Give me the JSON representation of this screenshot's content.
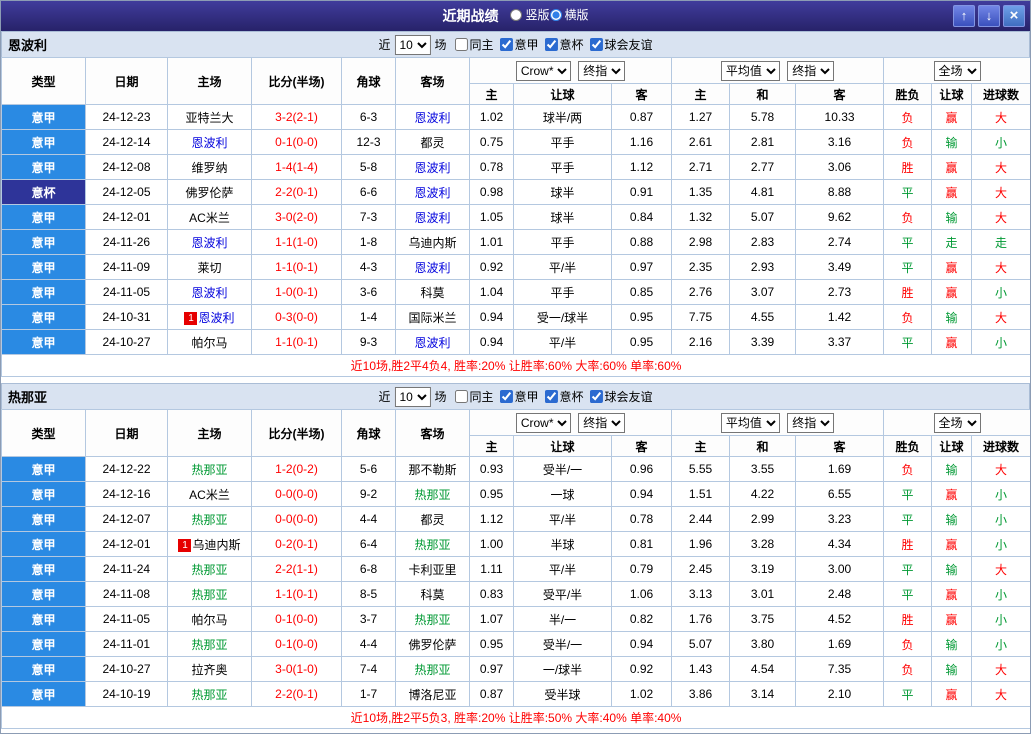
{
  "titlebar": {
    "title": "近期战绩",
    "layout_options": [
      {
        "label": "竖版",
        "selected": false
      },
      {
        "label": "横版",
        "selected": true
      }
    ],
    "up_icon": "↑",
    "down_icon": "↓",
    "close_icon": "×"
  },
  "controls": {
    "near_label": "近",
    "count": "10",
    "matches_label": "场",
    "checkboxes": [
      {
        "label": "同主",
        "checked": false
      },
      {
        "label": "意甲",
        "checked": true
      },
      {
        "label": "意杯",
        "checked": true
      },
      {
        "label": "球会友谊",
        "checked": true
      }
    ]
  },
  "header": {
    "cols": [
      "类型",
      "日期",
      "主场",
      "比分(半场)",
      "角球",
      "客场"
    ],
    "odds1": {
      "company": "Crow*",
      "time": "终指",
      "cols": [
        "主",
        "让球",
        "客"
      ]
    },
    "odds2": {
      "name": "平均值",
      "time": "终指",
      "cols": [
        "主",
        "和",
        "客"
      ]
    },
    "scope": "全场",
    "result_cols": [
      "胜负",
      "让球",
      "进球数"
    ]
  },
  "colors": {
    "league": {
      "意甲": "#2a8ae3",
      "意杯": "#2e3499"
    },
    "score": "#ff0000",
    "summary": "#ff0000",
    "mark": "#e60000",
    "outcome": {
      "胜": "#ff0000",
      "负": "#ff0000",
      "平": "#009933",
      "赢": "#ff0000",
      "输": "#009933",
      "走": "#009933",
      "大": "#ff0000",
      "小": "#009933"
    }
  },
  "sections": [
    {
      "team": "恩波利",
      "team_color": "#0000dd",
      "summary": "近10场,胜2平4负4, 胜率:20% 让胜率:60% 大率:60% 单率:60%",
      "rows": [
        {
          "lg": "意甲",
          "date": "24-12-23",
          "home": "亚特兰大",
          "score": "3-2(2-1)",
          "cor": "6-3",
          "away": "恩波利",
          "o1": "1.02",
          "hc": "球半/两",
          "o2": "0.87",
          "e1": "1.27",
          "e2": "5.78",
          "e3": "10.33",
          "r1": "负",
          "r2": "赢",
          "r3": "大"
        },
        {
          "lg": "意甲",
          "date": "24-12-14",
          "home": "恩波利",
          "score": "0-1(0-0)",
          "cor": "12-3",
          "away": "都灵",
          "o1": "0.75",
          "hc": "平手",
          "o2": "1.16",
          "e1": "2.61",
          "e2": "2.81",
          "e3": "3.16",
          "r1": "负",
          "r2": "输",
          "r3": "小"
        },
        {
          "lg": "意甲",
          "date": "24-12-08",
          "home": "维罗纳",
          "score": "1-4(1-4)",
          "cor": "5-8",
          "away": "恩波利",
          "o1": "0.78",
          "hc": "平手",
          "o2": "1.12",
          "e1": "2.71",
          "e2": "2.77",
          "e3": "3.06",
          "r1": "胜",
          "r2": "赢",
          "r3": "大"
        },
        {
          "lg": "意杯",
          "date": "24-12-05",
          "home": "佛罗伦萨",
          "score": "2-2(0-1)",
          "cor": "6-6",
          "away": "恩波利",
          "o1": "0.98",
          "hc": "球半",
          "o2": "0.91",
          "e1": "1.35",
          "e2": "4.81",
          "e3": "8.88",
          "r1": "平",
          "r2": "赢",
          "r3": "大"
        },
        {
          "lg": "意甲",
          "date": "24-12-01",
          "home": "AC米兰",
          "score": "3-0(2-0)",
          "cor": "7-3",
          "away": "恩波利",
          "o1": "1.05",
          "hc": "球半",
          "o2": "0.84",
          "e1": "1.32",
          "e2": "5.07",
          "e3": "9.62",
          "r1": "负",
          "r2": "输",
          "r3": "大"
        },
        {
          "lg": "意甲",
          "date": "24-11-26",
          "home": "恩波利",
          "score": "1-1(1-0)",
          "cor": "1-8",
          "away": "乌迪内斯",
          "o1": "1.01",
          "hc": "平手",
          "o2": "0.88",
          "e1": "2.98",
          "e2": "2.83",
          "e3": "2.74",
          "r1": "平",
          "r2": "走",
          "r3": "走"
        },
        {
          "lg": "意甲",
          "date": "24-11-09",
          "home": "莱切",
          "score": "1-1(0-1)",
          "cor": "4-3",
          "away": "恩波利",
          "o1": "0.92",
          "hc": "平/半",
          "o2": "0.97",
          "e1": "2.35",
          "e2": "2.93",
          "e3": "3.49",
          "r1": "平",
          "r2": "赢",
          "r3": "大"
        },
        {
          "lg": "意甲",
          "date": "24-11-05",
          "home": "恩波利",
          "score": "1-0(0-1)",
          "cor": "3-6",
          "away": "科莫",
          "o1": "1.04",
          "hc": "平手",
          "o2": "0.85",
          "e1": "2.76",
          "e2": "3.07",
          "e3": "2.73",
          "r1": "胜",
          "r2": "赢",
          "r3": "小"
        },
        {
          "lg": "意甲",
          "date": "24-10-31",
          "home": "恩波利",
          "hm": "1",
          "score": "0-3(0-0)",
          "cor": "1-4",
          "away": "国际米兰",
          "o1": "0.94",
          "hc": "受一/球半",
          "o2": "0.95",
          "e1": "7.75",
          "e2": "4.55",
          "e3": "1.42",
          "r1": "负",
          "r2": "输",
          "r3": "大"
        },
        {
          "lg": "意甲",
          "date": "24-10-27",
          "home": "帕尔马",
          "score": "1-1(0-1)",
          "cor": "9-3",
          "away": "恩波利",
          "o1": "0.94",
          "hc": "平/半",
          "o2": "0.95",
          "e1": "2.16",
          "e2": "3.39",
          "e3": "3.37",
          "r1": "平",
          "r2": "赢",
          "r3": "小"
        }
      ]
    },
    {
      "team": "热那亚",
      "team_color": "#009933",
      "summary": "近10场,胜2平5负3, 胜率:20% 让胜率:50% 大率:40% 单率:40%",
      "rows": [
        {
          "lg": "意甲",
          "date": "24-12-22",
          "home": "热那亚",
          "score": "1-2(0-2)",
          "cor": "5-6",
          "away": "那不勒斯",
          "o1": "0.93",
          "hc": "受半/一",
          "o2": "0.96",
          "e1": "5.55",
          "e2": "3.55",
          "e3": "1.69",
          "r1": "负",
          "r2": "输",
          "r3": "大"
        },
        {
          "lg": "意甲",
          "date": "24-12-16",
          "home": "AC米兰",
          "score": "0-0(0-0)",
          "cor": "9-2",
          "away": "热那亚",
          "o1": "0.95",
          "hc": "一球",
          "o2": "0.94",
          "e1": "1.51",
          "e2": "4.22",
          "e3": "6.55",
          "r1": "平",
          "r2": "赢",
          "r3": "小"
        },
        {
          "lg": "意甲",
          "date": "24-12-07",
          "home": "热那亚",
          "score": "0-0(0-0)",
          "cor": "4-4",
          "away": "都灵",
          "o1": "1.12",
          "hc": "平/半",
          "o2": "0.78",
          "e1": "2.44",
          "e2": "2.99",
          "e3": "3.23",
          "r1": "平",
          "r2": "输",
          "r3": "小"
        },
        {
          "lg": "意甲",
          "date": "24-12-01",
          "home": "乌迪内斯",
          "hm": "1",
          "score": "0-2(0-1)",
          "cor": "6-4",
          "away": "热那亚",
          "o1": "1.00",
          "hc": "半球",
          "o2": "0.81",
          "e1": "1.96",
          "e2": "3.28",
          "e3": "4.34",
          "r1": "胜",
          "r2": "赢",
          "r3": "小"
        },
        {
          "lg": "意甲",
          "date": "24-11-24",
          "home": "热那亚",
          "score": "2-2(1-1)",
          "cor": "6-8",
          "away": "卡利亚里",
          "o1": "1.11",
          "hc": "平/半",
          "o2": "0.79",
          "e1": "2.45",
          "e2": "3.19",
          "e3": "3.00",
          "r1": "平",
          "r2": "输",
          "r3": "大"
        },
        {
          "lg": "意甲",
          "date": "24-11-08",
          "home": "热那亚",
          "score": "1-1(0-1)",
          "cor": "8-5",
          "away": "科莫",
          "o1": "0.83",
          "hc": "受平/半",
          "o2": "1.06",
          "e1": "3.13",
          "e2": "3.01",
          "e3": "2.48",
          "r1": "平",
          "r2": "赢",
          "r3": "小"
        },
        {
          "lg": "意甲",
          "date": "24-11-05",
          "home": "帕尔马",
          "score": "0-1(0-0)",
          "cor": "3-7",
          "away": "热那亚",
          "o1": "1.07",
          "hc": "半/一",
          "o2": "0.82",
          "e1": "1.76",
          "e2": "3.75",
          "e3": "4.52",
          "r1": "胜",
          "r2": "赢",
          "r3": "小"
        },
        {
          "lg": "意甲",
          "date": "24-11-01",
          "home": "热那亚",
          "score": "0-1(0-0)",
          "cor": "4-4",
          "away": "佛罗伦萨",
          "o1": "0.95",
          "hc": "受半/一",
          "o2": "0.94",
          "e1": "5.07",
          "e2": "3.80",
          "e3": "1.69",
          "r1": "负",
          "r2": "输",
          "r3": "小"
        },
        {
          "lg": "意甲",
          "date": "24-10-27",
          "home": "拉齐奥",
          "score": "3-0(1-0)",
          "cor": "7-4",
          "away": "热那亚",
          "o1": "0.97",
          "hc": "一/球半",
          "o2": "0.92",
          "e1": "1.43",
          "e2": "4.54",
          "e3": "7.35",
          "r1": "负",
          "r2": "输",
          "r3": "大"
        },
        {
          "lg": "意甲",
          "date": "24-10-19",
          "home": "热那亚",
          "score": "2-2(0-1)",
          "cor": "1-7",
          "away": "博洛尼亚",
          "o1": "0.87",
          "hc": "受半球",
          "o2": "1.02",
          "e1": "3.86",
          "e2": "3.14",
          "e3": "2.10",
          "r1": "平",
          "r2": "赢",
          "r3": "大"
        }
      ]
    }
  ]
}
